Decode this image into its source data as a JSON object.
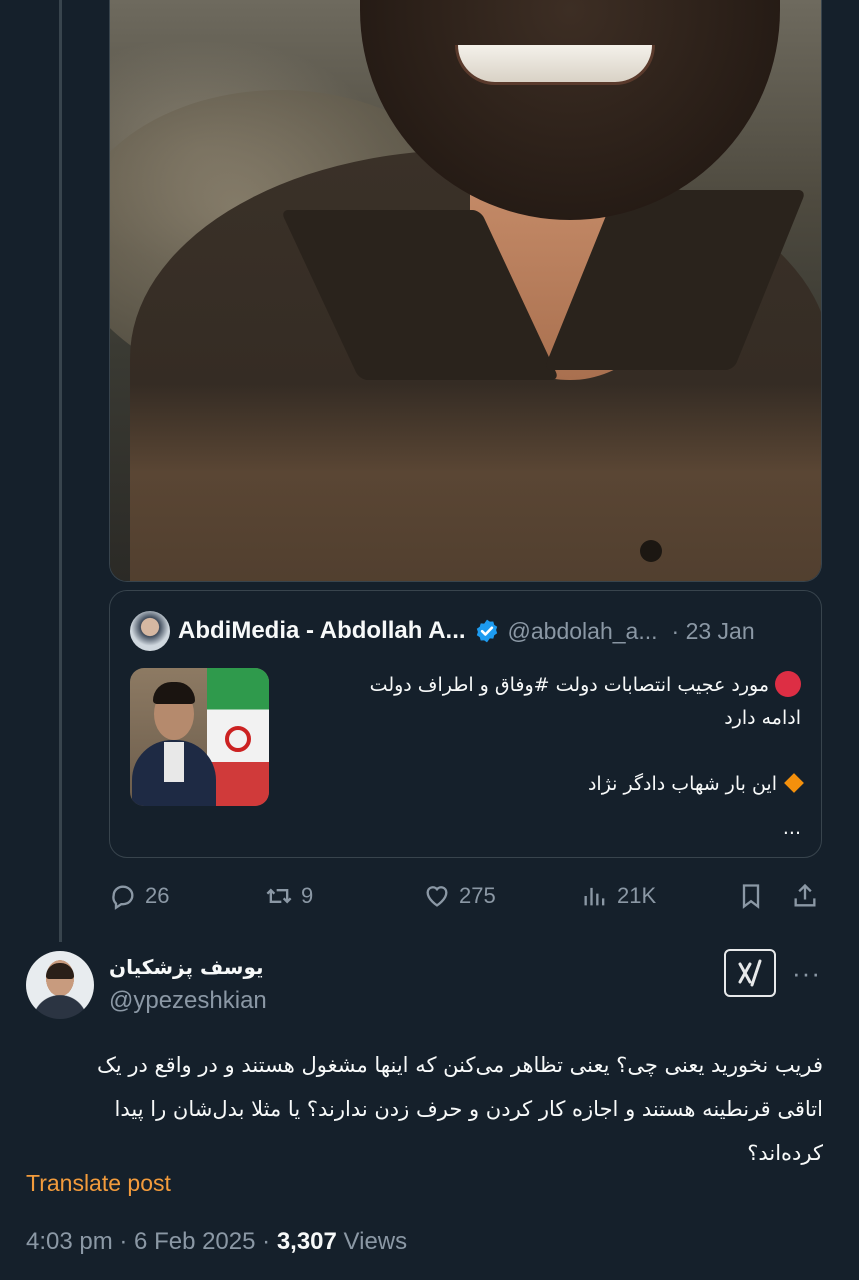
{
  "quoted_post": {
    "author_name": "AbdiMedia - Abdollah A...",
    "author_handle": "@abdolah_a...",
    "date": "· 23 Jan",
    "text_lines": [
      "مورد عجیب انتصابات دولت #وفاق و اطراف دولت",
      "ادامه دارد",
      "این بار شهاب دادگر نژاد"
    ],
    "more": "..."
  },
  "actions": {
    "replies": "26",
    "reposts": "9",
    "likes": "275",
    "views": "21K"
  },
  "post": {
    "author_name": "یوسف پزشکیان",
    "author_handle": "@ypezeshkian",
    "text_lines": [
      "فریب نخورید یعنی چی؟ یعنی تظاهر می‌کنن که اینها مشغول هستند و در واقع در یک",
      "اتاقی قرنطینه هستند و اجازه کار کردن و حرف زدن ندارند؟ یا مثلا بدل‌شان را پیدا",
      "کرده‌اند؟"
    ],
    "translate_label": "Translate post",
    "time": "4:03 pm · 6 Feb 2025 · ",
    "views_count": "3,307",
    "views_label": " Views"
  },
  "colors": {
    "background": "#15202b",
    "text": "#f7f9f9",
    "secondary": "#8b98a5",
    "border": "#38444d",
    "translate": "#f29b3c",
    "verified": "#1d9bf0"
  },
  "icons": [
    "reply-icon",
    "repost-icon",
    "like-icon",
    "views-icon",
    "bookmark-icon",
    "share-icon",
    "grok-icon",
    "more-icon",
    "verified-icon"
  ]
}
